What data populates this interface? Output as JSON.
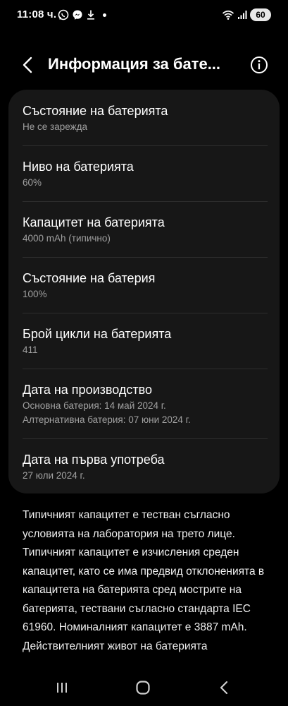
{
  "status": {
    "time": "11:08 ч.",
    "battery": "60",
    "icons_left": [
      "whatsapp-icon",
      "messenger-icon",
      "download-icon",
      "notification-dot"
    ],
    "icons_right": [
      "wifi-icon",
      "signal-icon",
      "battery-icon"
    ]
  },
  "header": {
    "title": "Информация за бате...",
    "back_icon": "back-icon",
    "info_icon": "info-icon"
  },
  "items": [
    {
      "title": "Състояние на батерията",
      "subtitle": "Не се зарежда"
    },
    {
      "title": "Ниво на батерията",
      "subtitle": "60%"
    },
    {
      "title": "Капацитет на батерията",
      "subtitle": "4000 mAh (типично)"
    },
    {
      "title": "Състояние на батерия",
      "subtitle": "100%"
    },
    {
      "title": "Брой цикли на батерията",
      "subtitle": "411"
    },
    {
      "title": "Дата на производство",
      "subtitle": "Основна батерия: 14 май 2024 г.",
      "subtitle2": "Алтернативна батерия: 07 юни 2024 г."
    },
    {
      "title": "Дата на първа употреба",
      "subtitle": "27 юли 2024 г."
    }
  ],
  "description": "Типичният капацитет е тестван съгласно условията на лаборатория на трето лице. Типичният капацитет е изчисления среден капацитет, като се има предвид отклоненията в капацитета на батерията сред мострите на батерията, тествани съгласно стандарта IEC 61960. Номиналният капацитет е 3887 mAh. Действителният живот на батерията",
  "nav": {
    "recents_icon": "recents-icon",
    "home_icon": "home-icon",
    "back_icon": "nav-back-icon"
  },
  "colors": {
    "background": "#000000",
    "card": "#171717",
    "subtitle": "#a0a0a0",
    "divider": "#2e2e2e"
  }
}
